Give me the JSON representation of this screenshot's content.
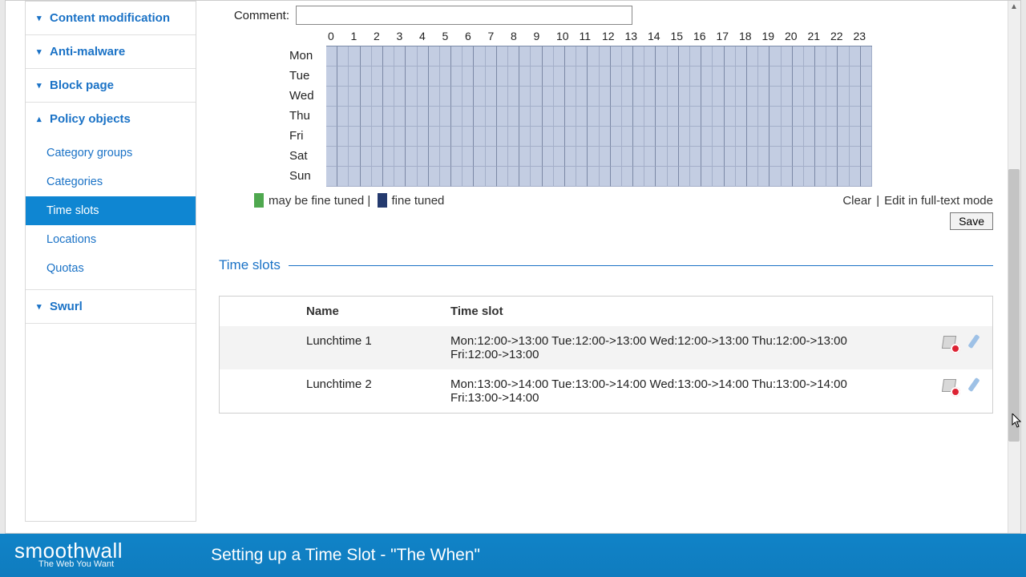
{
  "sidebar": {
    "groups": [
      {
        "label": "Content modification",
        "expanded": false
      },
      {
        "label": "Anti-malware",
        "expanded": false
      },
      {
        "label": "Block page",
        "expanded": false
      },
      {
        "label": "Policy objects",
        "expanded": true,
        "items": [
          {
            "label": "Category groups"
          },
          {
            "label": "Categories"
          },
          {
            "label": "Time slots",
            "active": true
          },
          {
            "label": "Locations"
          },
          {
            "label": "Quotas"
          }
        ]
      },
      {
        "label": "Swurl",
        "expanded": false
      }
    ]
  },
  "form": {
    "comment_label": "Comment:",
    "comment_value": ""
  },
  "grid": {
    "hours": [
      "0",
      "1",
      "2",
      "3",
      "4",
      "5",
      "6",
      "7",
      "8",
      "9",
      "10",
      "11",
      "12",
      "13",
      "14",
      "15",
      "16",
      "17",
      "18",
      "19",
      "20",
      "21",
      "22",
      "23"
    ],
    "days": [
      "Mon",
      "Tue",
      "Wed",
      "Thu",
      "Fri",
      "Sat",
      "Sun"
    ]
  },
  "legend": {
    "may": "may be fine tuned",
    "sep": "|",
    "fine": "fine tuned",
    "clear": "Clear",
    "bar": "|",
    "edit": "Edit in full-text mode"
  },
  "save_btn": "Save",
  "section_title": "Time slots",
  "table": {
    "headers": {
      "name": "Name",
      "slot": "Time slot"
    },
    "rows": [
      {
        "name": "Lunchtime 1",
        "slot": "Mon:12:00->13:00 Tue:12:00->13:00 Wed:12:00->13:00 Thu:12:00->13:00 Fri:12:00->13:00"
      },
      {
        "name": "Lunchtime 2",
        "slot": "Mon:13:00->14:00 Tue:13:00->14:00 Wed:13:00->14:00 Thu:13:00->14:00 Fri:13:00->14:00"
      }
    ]
  },
  "footer": {
    "logo1": "smooth",
    "logo2": "wall",
    "tagline": "The Web You Want",
    "title": "Setting up a Time Slot - \"The When\""
  }
}
